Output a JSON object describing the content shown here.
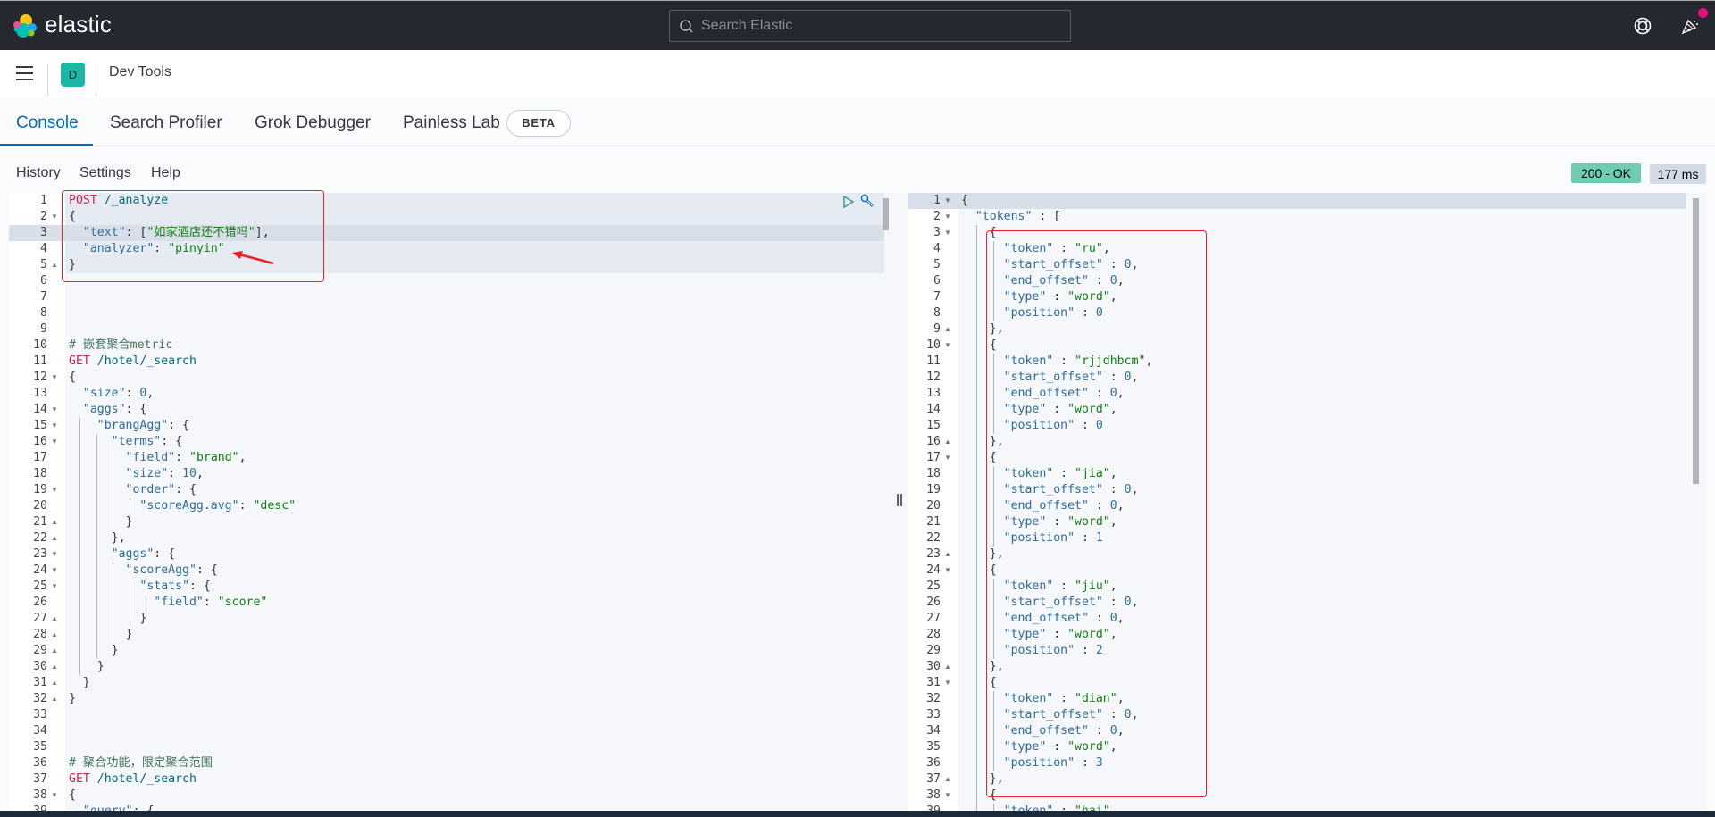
{
  "header": {
    "logo_text": "elastic",
    "search_placeholder": "Search Elastic",
    "icons": [
      "help-lifebuoy-icon",
      "newsfeed-cheer-icon"
    ]
  },
  "nav": {
    "avatar_letter": "D",
    "breadcrumb": "Dev Tools"
  },
  "tabs": [
    {
      "label": "Console",
      "active": true
    },
    {
      "label": "Search Profiler",
      "active": false
    },
    {
      "label": "Grok Debugger",
      "active": false
    },
    {
      "label": "Painless Lab",
      "active": false
    }
  ],
  "beta_badge": "BETA",
  "toolbar": {
    "history": "History",
    "settings": "Settings",
    "help": "Help",
    "status": "200 - OK",
    "duration": "177 ms"
  },
  "colors": {
    "accent": "#006bb8",
    "status_ok": "#6dccb1",
    "avatar": "#1bb6a6",
    "notification": "#e5107a"
  },
  "request_lines": [
    {
      "n": "1",
      "fold": "",
      "tokens": [
        [
          "t-method",
          "POST"
        ],
        [
          "t-url",
          " /_analyze"
        ]
      ]
    },
    {
      "n": "2",
      "fold": "down",
      "tokens": [
        [
          "t-punc",
          "{"
        ]
      ]
    },
    {
      "n": "3",
      "fold": "",
      "tokens": [
        [
          "t-punc",
          "  "
        ],
        [
          "t-key",
          "\"text\""
        ],
        [
          "t-punc",
          ": ["
        ],
        [
          "t-str",
          "\"如家酒店还不错吗\""
        ],
        [
          "t-punc",
          "],"
        ]
      ]
    },
    {
      "n": "4",
      "fold": "",
      "tokens": [
        [
          "t-punc",
          "  "
        ],
        [
          "t-key",
          "\"analyzer\""
        ],
        [
          "t-punc",
          ": "
        ],
        [
          "t-str",
          "\"pinyin\""
        ]
      ]
    },
    {
      "n": "5",
      "fold": "up",
      "tokens": [
        [
          "t-punc",
          "}"
        ]
      ]
    },
    {
      "n": "6",
      "fold": "",
      "tokens": []
    },
    {
      "n": "7",
      "fold": "",
      "tokens": []
    },
    {
      "n": "8",
      "fold": "",
      "tokens": []
    },
    {
      "n": "9",
      "fold": "",
      "tokens": []
    },
    {
      "n": "10",
      "fold": "",
      "tokens": [
        [
          "t-comment",
          "# 嵌套聚合metric"
        ]
      ]
    },
    {
      "n": "11",
      "fold": "",
      "tokens": [
        [
          "t-method",
          "GET"
        ],
        [
          "t-url",
          " /hotel/_search"
        ]
      ]
    },
    {
      "n": "12",
      "fold": "down",
      "tokens": [
        [
          "t-punc",
          "{"
        ]
      ]
    },
    {
      "n": "13",
      "fold": "",
      "tokens": [
        [
          "t-punc",
          "  "
        ],
        [
          "t-key",
          "\"size\""
        ],
        [
          "t-punc",
          ": "
        ],
        [
          "t-num",
          "0"
        ],
        [
          "t-punc",
          ","
        ]
      ]
    },
    {
      "n": "14",
      "fold": "down",
      "tokens": [
        [
          "t-punc",
          "  "
        ],
        [
          "t-key",
          "\"aggs\""
        ],
        [
          "t-punc",
          ": {"
        ]
      ]
    },
    {
      "n": "15",
      "fold": "down",
      "tokens": [
        [
          "t-punc",
          "    "
        ],
        [
          "t-key",
          "\"brangAgg\""
        ],
        [
          "t-punc",
          ": {"
        ]
      ]
    },
    {
      "n": "16",
      "fold": "down",
      "tokens": [
        [
          "t-punc",
          "      "
        ],
        [
          "t-key",
          "\"terms\""
        ],
        [
          "t-punc",
          ": {"
        ]
      ]
    },
    {
      "n": "17",
      "fold": "",
      "tokens": [
        [
          "t-punc",
          "        "
        ],
        [
          "t-key",
          "\"field\""
        ],
        [
          "t-punc",
          ": "
        ],
        [
          "t-str",
          "\"brand\""
        ],
        [
          "t-punc",
          ","
        ]
      ]
    },
    {
      "n": "18",
      "fold": "",
      "tokens": [
        [
          "t-punc",
          "        "
        ],
        [
          "t-key",
          "\"size\""
        ],
        [
          "t-punc",
          ": "
        ],
        [
          "t-num",
          "10"
        ],
        [
          "t-punc",
          ","
        ]
      ]
    },
    {
      "n": "19",
      "fold": "down",
      "tokens": [
        [
          "t-punc",
          "        "
        ],
        [
          "t-key",
          "\"order\""
        ],
        [
          "t-punc",
          ": {"
        ]
      ]
    },
    {
      "n": "20",
      "fold": "",
      "tokens": [
        [
          "t-punc",
          "          "
        ],
        [
          "t-key",
          "\"scoreAgg.avg\""
        ],
        [
          "t-punc",
          ": "
        ],
        [
          "t-str",
          "\"desc\""
        ]
      ]
    },
    {
      "n": "21",
      "fold": "up",
      "tokens": [
        [
          "t-punc",
          "        }"
        ]
      ]
    },
    {
      "n": "22",
      "fold": "up",
      "tokens": [
        [
          "t-punc",
          "      },"
        ]
      ]
    },
    {
      "n": "23",
      "fold": "down",
      "tokens": [
        [
          "t-punc",
          "      "
        ],
        [
          "t-key",
          "\"aggs\""
        ],
        [
          "t-punc",
          ": {"
        ]
      ]
    },
    {
      "n": "24",
      "fold": "down",
      "tokens": [
        [
          "t-punc",
          "        "
        ],
        [
          "t-key",
          "\"scoreAgg\""
        ],
        [
          "t-punc",
          ": {"
        ]
      ]
    },
    {
      "n": "25",
      "fold": "down",
      "tokens": [
        [
          "t-punc",
          "          "
        ],
        [
          "t-key",
          "\"stats\""
        ],
        [
          "t-punc",
          ": {"
        ]
      ]
    },
    {
      "n": "26",
      "fold": "",
      "tokens": [
        [
          "t-punc",
          "            "
        ],
        [
          "t-key",
          "\"field\""
        ],
        [
          "t-punc",
          ": "
        ],
        [
          "t-str",
          "\"score\""
        ]
      ]
    },
    {
      "n": "27",
      "fold": "up",
      "tokens": [
        [
          "t-punc",
          "          }"
        ]
      ]
    },
    {
      "n": "28",
      "fold": "up",
      "tokens": [
        [
          "t-punc",
          "        }"
        ]
      ]
    },
    {
      "n": "29",
      "fold": "up",
      "tokens": [
        [
          "t-punc",
          "      }"
        ]
      ]
    },
    {
      "n": "30",
      "fold": "up",
      "tokens": [
        [
          "t-punc",
          "    }"
        ]
      ]
    },
    {
      "n": "31",
      "fold": "up",
      "tokens": [
        [
          "t-punc",
          "  }"
        ]
      ]
    },
    {
      "n": "32",
      "fold": "up",
      "tokens": [
        [
          "t-punc",
          "}"
        ]
      ]
    },
    {
      "n": "33",
      "fold": "",
      "tokens": []
    },
    {
      "n": "34",
      "fold": "",
      "tokens": []
    },
    {
      "n": "35",
      "fold": "",
      "tokens": []
    },
    {
      "n": "36",
      "fold": "",
      "tokens": [
        [
          "t-comment",
          "# 聚合功能，限定聚合范围"
        ]
      ]
    },
    {
      "n": "37",
      "fold": "",
      "tokens": [
        [
          "t-method",
          "GET"
        ],
        [
          "t-url",
          " /hotel/_search"
        ]
      ]
    },
    {
      "n": "38",
      "fold": "down",
      "tokens": [
        [
          "t-punc",
          "{"
        ]
      ]
    },
    {
      "n": "39",
      "fold": "",
      "tokens": [
        [
          "t-punc",
          "  "
        ],
        [
          "t-key",
          "\"query\""
        ],
        [
          "t-punc",
          ": {"
        ]
      ]
    }
  ],
  "response_lines": [
    {
      "n": "1",
      "fold": "down",
      "tokens": [
        [
          "t-punc",
          "{"
        ]
      ]
    },
    {
      "n": "2",
      "fold": "down",
      "tokens": [
        [
          "t-punc",
          "  "
        ],
        [
          "t-key",
          "\"tokens\""
        ],
        [
          "t-punc",
          " : ["
        ]
      ]
    },
    {
      "n": "3",
      "fold": "down",
      "tokens": [
        [
          "t-punc",
          "    {"
        ]
      ]
    },
    {
      "n": "4",
      "fold": "",
      "tokens": [
        [
          "t-punc",
          "      "
        ],
        [
          "t-key",
          "\"token\""
        ],
        [
          "t-punc",
          " : "
        ],
        [
          "t-str",
          "\"ru\""
        ],
        [
          "t-punc",
          ","
        ]
      ]
    },
    {
      "n": "5",
      "fold": "",
      "tokens": [
        [
          "t-punc",
          "      "
        ],
        [
          "t-key",
          "\"start_offset\""
        ],
        [
          "t-punc",
          " : "
        ],
        [
          "t-num",
          "0"
        ],
        [
          "t-punc",
          ","
        ]
      ]
    },
    {
      "n": "6",
      "fold": "",
      "tokens": [
        [
          "t-punc",
          "      "
        ],
        [
          "t-key",
          "\"end_offset\""
        ],
        [
          "t-punc",
          " : "
        ],
        [
          "t-num",
          "0"
        ],
        [
          "t-punc",
          ","
        ]
      ]
    },
    {
      "n": "7",
      "fold": "",
      "tokens": [
        [
          "t-punc",
          "      "
        ],
        [
          "t-key",
          "\"type\""
        ],
        [
          "t-punc",
          " : "
        ],
        [
          "t-str",
          "\"word\""
        ],
        [
          "t-punc",
          ","
        ]
      ]
    },
    {
      "n": "8",
      "fold": "",
      "tokens": [
        [
          "t-punc",
          "      "
        ],
        [
          "t-key",
          "\"position\""
        ],
        [
          "t-punc",
          " : "
        ],
        [
          "t-num",
          "0"
        ]
      ]
    },
    {
      "n": "9",
      "fold": "up",
      "tokens": [
        [
          "t-punc",
          "    },"
        ]
      ]
    },
    {
      "n": "10",
      "fold": "down",
      "tokens": [
        [
          "t-punc",
          "    {"
        ]
      ]
    },
    {
      "n": "11",
      "fold": "",
      "tokens": [
        [
          "t-punc",
          "      "
        ],
        [
          "t-key",
          "\"token\""
        ],
        [
          "t-punc",
          " : "
        ],
        [
          "t-str",
          "\"rjjdhbcm\""
        ],
        [
          "t-punc",
          ","
        ]
      ]
    },
    {
      "n": "12",
      "fold": "",
      "tokens": [
        [
          "t-punc",
          "      "
        ],
        [
          "t-key",
          "\"start_offset\""
        ],
        [
          "t-punc",
          " : "
        ],
        [
          "t-num",
          "0"
        ],
        [
          "t-punc",
          ","
        ]
      ]
    },
    {
      "n": "13",
      "fold": "",
      "tokens": [
        [
          "t-punc",
          "      "
        ],
        [
          "t-key",
          "\"end_offset\""
        ],
        [
          "t-punc",
          " : "
        ],
        [
          "t-num",
          "0"
        ],
        [
          "t-punc",
          ","
        ]
      ]
    },
    {
      "n": "14",
      "fold": "",
      "tokens": [
        [
          "t-punc",
          "      "
        ],
        [
          "t-key",
          "\"type\""
        ],
        [
          "t-punc",
          " : "
        ],
        [
          "t-str",
          "\"word\""
        ],
        [
          "t-punc",
          ","
        ]
      ]
    },
    {
      "n": "15",
      "fold": "",
      "tokens": [
        [
          "t-punc",
          "      "
        ],
        [
          "t-key",
          "\"position\""
        ],
        [
          "t-punc",
          " : "
        ],
        [
          "t-num",
          "0"
        ]
      ]
    },
    {
      "n": "16",
      "fold": "up",
      "tokens": [
        [
          "t-punc",
          "    },"
        ]
      ]
    },
    {
      "n": "17",
      "fold": "down",
      "tokens": [
        [
          "t-punc",
          "    {"
        ]
      ]
    },
    {
      "n": "18",
      "fold": "",
      "tokens": [
        [
          "t-punc",
          "      "
        ],
        [
          "t-key",
          "\"token\""
        ],
        [
          "t-punc",
          " : "
        ],
        [
          "t-str",
          "\"jia\""
        ],
        [
          "t-punc",
          ","
        ]
      ]
    },
    {
      "n": "19",
      "fold": "",
      "tokens": [
        [
          "t-punc",
          "      "
        ],
        [
          "t-key",
          "\"start_offset\""
        ],
        [
          "t-punc",
          " : "
        ],
        [
          "t-num",
          "0"
        ],
        [
          "t-punc",
          ","
        ]
      ]
    },
    {
      "n": "20",
      "fold": "",
      "tokens": [
        [
          "t-punc",
          "      "
        ],
        [
          "t-key",
          "\"end_offset\""
        ],
        [
          "t-punc",
          " : "
        ],
        [
          "t-num",
          "0"
        ],
        [
          "t-punc",
          ","
        ]
      ]
    },
    {
      "n": "21",
      "fold": "",
      "tokens": [
        [
          "t-punc",
          "      "
        ],
        [
          "t-key",
          "\"type\""
        ],
        [
          "t-punc",
          " : "
        ],
        [
          "t-str",
          "\"word\""
        ],
        [
          "t-punc",
          ","
        ]
      ]
    },
    {
      "n": "22",
      "fold": "",
      "tokens": [
        [
          "t-punc",
          "      "
        ],
        [
          "t-key",
          "\"position\""
        ],
        [
          "t-punc",
          " : "
        ],
        [
          "t-num",
          "1"
        ]
      ]
    },
    {
      "n": "23",
      "fold": "up",
      "tokens": [
        [
          "t-punc",
          "    },"
        ]
      ]
    },
    {
      "n": "24",
      "fold": "down",
      "tokens": [
        [
          "t-punc",
          "    {"
        ]
      ]
    },
    {
      "n": "25",
      "fold": "",
      "tokens": [
        [
          "t-punc",
          "      "
        ],
        [
          "t-key",
          "\"token\""
        ],
        [
          "t-punc",
          " : "
        ],
        [
          "t-str",
          "\"jiu\""
        ],
        [
          "t-punc",
          ","
        ]
      ]
    },
    {
      "n": "26",
      "fold": "",
      "tokens": [
        [
          "t-punc",
          "      "
        ],
        [
          "t-key",
          "\"start_offset\""
        ],
        [
          "t-punc",
          " : "
        ],
        [
          "t-num",
          "0"
        ],
        [
          "t-punc",
          ","
        ]
      ]
    },
    {
      "n": "27",
      "fold": "",
      "tokens": [
        [
          "t-punc",
          "      "
        ],
        [
          "t-key",
          "\"end_offset\""
        ],
        [
          "t-punc",
          " : "
        ],
        [
          "t-num",
          "0"
        ],
        [
          "t-punc",
          ","
        ]
      ]
    },
    {
      "n": "28",
      "fold": "",
      "tokens": [
        [
          "t-punc",
          "      "
        ],
        [
          "t-key",
          "\"type\""
        ],
        [
          "t-punc",
          " : "
        ],
        [
          "t-str",
          "\"word\""
        ],
        [
          "t-punc",
          ","
        ]
      ]
    },
    {
      "n": "29",
      "fold": "",
      "tokens": [
        [
          "t-punc",
          "      "
        ],
        [
          "t-key",
          "\"position\""
        ],
        [
          "t-punc",
          " : "
        ],
        [
          "t-num",
          "2"
        ]
      ]
    },
    {
      "n": "30",
      "fold": "up",
      "tokens": [
        [
          "t-punc",
          "    },"
        ]
      ]
    },
    {
      "n": "31",
      "fold": "down",
      "tokens": [
        [
          "t-punc",
          "    {"
        ]
      ]
    },
    {
      "n": "32",
      "fold": "",
      "tokens": [
        [
          "t-punc",
          "      "
        ],
        [
          "t-key",
          "\"token\""
        ],
        [
          "t-punc",
          " : "
        ],
        [
          "t-str",
          "\"dian\""
        ],
        [
          "t-punc",
          ","
        ]
      ]
    },
    {
      "n": "33",
      "fold": "",
      "tokens": [
        [
          "t-punc",
          "      "
        ],
        [
          "t-key",
          "\"start_offset\""
        ],
        [
          "t-punc",
          " : "
        ],
        [
          "t-num",
          "0"
        ],
        [
          "t-punc",
          ","
        ]
      ]
    },
    {
      "n": "34",
      "fold": "",
      "tokens": [
        [
          "t-punc",
          "      "
        ],
        [
          "t-key",
          "\"end_offset\""
        ],
        [
          "t-punc",
          " : "
        ],
        [
          "t-num",
          "0"
        ],
        [
          "t-punc",
          ","
        ]
      ]
    },
    {
      "n": "35",
      "fold": "",
      "tokens": [
        [
          "t-punc",
          "      "
        ],
        [
          "t-key",
          "\"type\""
        ],
        [
          "t-punc",
          " : "
        ],
        [
          "t-str",
          "\"word\""
        ],
        [
          "t-punc",
          ","
        ]
      ]
    },
    {
      "n": "36",
      "fold": "",
      "tokens": [
        [
          "t-punc",
          "      "
        ],
        [
          "t-key",
          "\"position\""
        ],
        [
          "t-punc",
          " : "
        ],
        [
          "t-num",
          "3"
        ]
      ]
    },
    {
      "n": "37",
      "fold": "up",
      "tokens": [
        [
          "t-punc",
          "    },"
        ]
      ]
    },
    {
      "n": "38",
      "fold": "down",
      "tokens": [
        [
          "t-punc",
          "    {"
        ]
      ]
    },
    {
      "n": "39",
      "fold": "",
      "tokens": [
        [
          "t-punc",
          "      "
        ],
        [
          "t-key",
          "\"token\""
        ],
        [
          "t-punc",
          " : "
        ],
        [
          "t-str",
          "\"hai\""
        ],
        [
          "t-punc",
          ","
        ]
      ]
    }
  ]
}
